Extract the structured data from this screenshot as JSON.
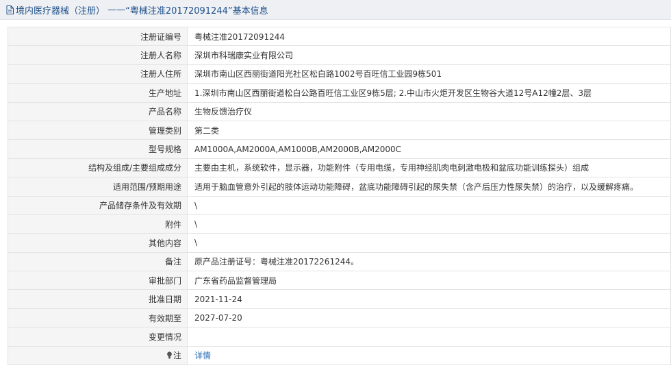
{
  "header": {
    "category": "境内医疗器械（注册）",
    "separator": " ——",
    "quoted_title": "“粤械注准20172091244”基本信息",
    "icon": "document-icon"
  },
  "rows": [
    {
      "label": "注册证编号",
      "value": "粤械注准20172091244"
    },
    {
      "label": "注册人名称",
      "value": "深圳市科瑞康实业有限公司"
    },
    {
      "label": "注册人住所",
      "value": "深圳市南山区西丽街道阳光社区松白路1002号百旺信工业园9栋501"
    },
    {
      "label": "生产地址",
      "value": "1.深圳市南山区西丽街道松白公路百旺信工业区9栋5层; 2.中山市火炬开发区生物谷大道12号A12幢2层、3层"
    },
    {
      "label": "产品名称",
      "value": "生物反馈治疗仪"
    },
    {
      "label": "管理类别",
      "value": "第二类"
    },
    {
      "label": "型号规格",
      "value": "AM1000A,AM2000A,AM1000B,AM2000B,AM2000C"
    },
    {
      "label": "结构及组成/主要组成成分",
      "value": "主要由主机，系统软件，显示器，功能附件（专用电缆，专用神经肌肉电刺激电极和盆底功能训练探头）组成"
    },
    {
      "label": "适用范围/预期用途",
      "value": "适用于脑血管意外引起的肢体运动功能障碍，盆底功能障碍引起的尿失禁（含产后压力性尿失禁）的治疗，以及缓解疼痛。"
    },
    {
      "label": "产品储存条件及有效期",
      "value": "\\"
    },
    {
      "label": "附件",
      "value": "\\"
    },
    {
      "label": "其他内容",
      "value": "\\"
    },
    {
      "label": "备注",
      "value": "原产品注册证号：粤械注准20172261244。"
    },
    {
      "label": "审批部门",
      "value": "广东省药品监督管理局"
    },
    {
      "label": "批准日期",
      "value": "2021-11-24"
    },
    {
      "label": "有效期至",
      "value": "2027-07-20"
    },
    {
      "label": "变更情况",
      "value": ""
    }
  ],
  "note_row": {
    "label": "注",
    "icon": "lightbulb-icon",
    "link_text": "详情"
  },
  "colors": {
    "title_text": "#1d4f8a",
    "title_bg": "#eef0f3",
    "label_bg": "#f5f5f5",
    "border": "#e3e3e3",
    "link": "#2a6ebb"
  }
}
